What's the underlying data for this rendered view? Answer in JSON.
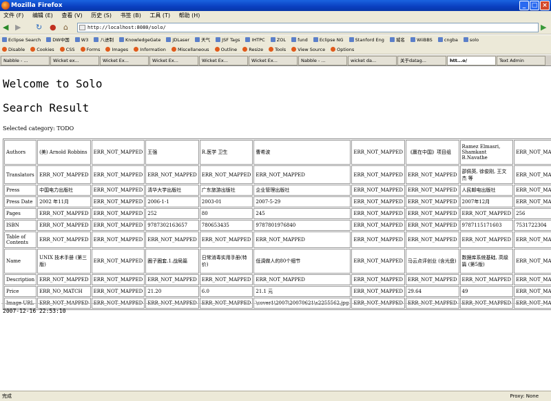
{
  "window": {
    "title": "Mozilla Firefox"
  },
  "menu": [
    "文件 (F)",
    "编辑 (E)",
    "查看 (V)",
    "历史 (S)",
    "书签 (B)",
    "工具 (T)",
    "帮助 (H)"
  ],
  "nav": {
    "url": "http://localhost:8080/solo/"
  },
  "bookmarks": [
    "Eclipse Search",
    "DW中国",
    "W3",
    "八进制",
    "KnowledgeGate",
    "JDLaser",
    "天气",
    "JSF Tags",
    "IHTPC",
    "ZOL",
    "fund",
    "Eclipse NG",
    "Stanford Eng",
    "城名",
    "WiiBBS",
    "cngba",
    "solo"
  ],
  "devbar": [
    "Disable",
    "Cookies",
    "CSS",
    "Forms",
    "Images",
    "Information",
    "Miscellaneous",
    "Outline",
    "Resize",
    "Tools",
    "View Source",
    "Options"
  ],
  "tabs": [
    "Nabble - ...",
    "Wicket ex...",
    "Wicket Ex...",
    "Wicket Ex...",
    "Wicket Ex...",
    "Wicket Ex...",
    "Nabble - ...",
    "wicket da...",
    "关于datag...",
    "htt...o/",
    "Text Admin"
  ],
  "active_tab": 9,
  "page": {
    "welcome": "Welcome to Solo",
    "search_result": "Search Result",
    "selected_category": "Selected category: TODO",
    "timestamp": "2007-12-16 22:53:10"
  },
  "table": [
    [
      "Authors",
      "(美) Arnold Robbins",
      "ERR_NOT_MAPPED",
      "王强",
      "R.医学 卫生",
      "曹希波",
      "ERR_NOT_MAPPED",
      "《赢在中国》项目组",
      "Ramez Elmasri, Shamkant B.Navathe",
      "ERR_NOT_MAPPED"
    ],
    [
      "Translators",
      "ERR_NOT_MAPPED",
      "ERR_NOT_MAPPED",
      "ERR_NOT_MAPPED",
      "ERR_NOT_MAPPED",
      "ERR_NOT_MAPPED",
      "ERR_NOT_MAPPED",
      "ERR_NOT_MAPPED",
      "邵佩英, 徐俊刚, 王文杰 等",
      "ERR_NOT_MAPPED"
    ],
    [
      "Press",
      "中国电力出版社",
      "ERR_NOT_MAPPED",
      "清华大学出版社",
      "广东旅游出版社",
      "企业管理出版社",
      "ERR_NOT_MAPPED",
      "ERR_NOT_MAPPED",
      "人民邮电出版社",
      "ERR_NOT_MAPPED"
    ],
    [
      "Press Date",
      "2002 年11月",
      "ERR_NOT_MAPPED",
      "2006-1-1",
      "2003-01",
      "2007-5-29",
      "ERR_NOT_MAPPED",
      "ERR_NOT_MAPPED",
      "2007年12月",
      "ERR_NOT_MAPPED"
    ],
    [
      "Pages",
      "ERR_NOT_MAPPED",
      "ERR_NOT_MAPPED",
      "252",
      "80",
      "245",
      "ERR_NOT_MAPPED",
      "ERR_NOT_MAPPED",
      "ERR_NOT_MAPPED",
      "256"
    ],
    [
      "ISBN",
      "ERR_NOT_MAPPED",
      "ERR_NOT_MAPPED",
      "9787302163657",
      "780653435",
      "9787801976840",
      "ERR_NOT_MAPPED",
      "ERR_NOT_MAPPED",
      "9787115171603",
      "7531722304"
    ],
    [
      "Table of Contents",
      "ERR_NOT_MAPPED",
      "ERR_NOT_MAPPED",
      "ERR_NOT_MAPPED",
      "ERR_NOT_MAPPED",
      "ERR_NOT_MAPPED",
      "ERR_NOT_MAPPED",
      "ERR_NOT_MAPPED",
      "ERR_NOT_MAPPED",
      "ERR_NOT_MAPPED"
    ],
    [
      "Name",
      "UNIX 技术手册 (第三版)",
      "ERR_NOT_MAPPED",
      "圈子圈套.1.战局篇",
      "日常消毒实用手册(特价)",
      "低调做人的80个细节",
      "ERR_NOT_MAPPED",
      "马云点评创业 (含光盘)",
      "数据库系统基础, 高级篇 (第5版)",
      "ERR_NOT_MAPPED"
    ],
    [
      "Description",
      "ERR_NOT_MAPPED",
      "ERR_NOT_MAPPED",
      "ERR_NOT_MAPPED",
      "ERR_NOT_MAPPED",
      "ERR_NOT_MAPPED",
      "ERR_NOT_MAPPED",
      "ERR_NOT_MAPPED",
      "ERR_NOT_MAPPED",
      "ERR_NOT_MAPPED"
    ],
    [
      "Price",
      "ERR_NO_MATCH",
      "ERR_NOT_MAPPED",
      "21.20",
      "6.0",
      "21.1 元",
      "ERR_NOT_MAPPED",
      "29.64",
      "49",
      "ERR_NOT_MAPPED"
    ],
    [
      "Image URL",
      "ERR_NOT_MAPPED",
      "ERR_NOT_MAPPED",
      "ERR_NOT_MAPPED",
      "ERR_NOT_MAPPED",
      "\\cover1\\2007\\20070621\\s2255562.jpg",
      "ERR_NOT_MAPPED",
      "ERR_NOT_MAPPED",
      "ERR_NOT_MAPPED",
      "ERR_NOT_MAPPED"
    ]
  ],
  "status": {
    "left": "完成",
    "proxy": "Proxy: None"
  }
}
